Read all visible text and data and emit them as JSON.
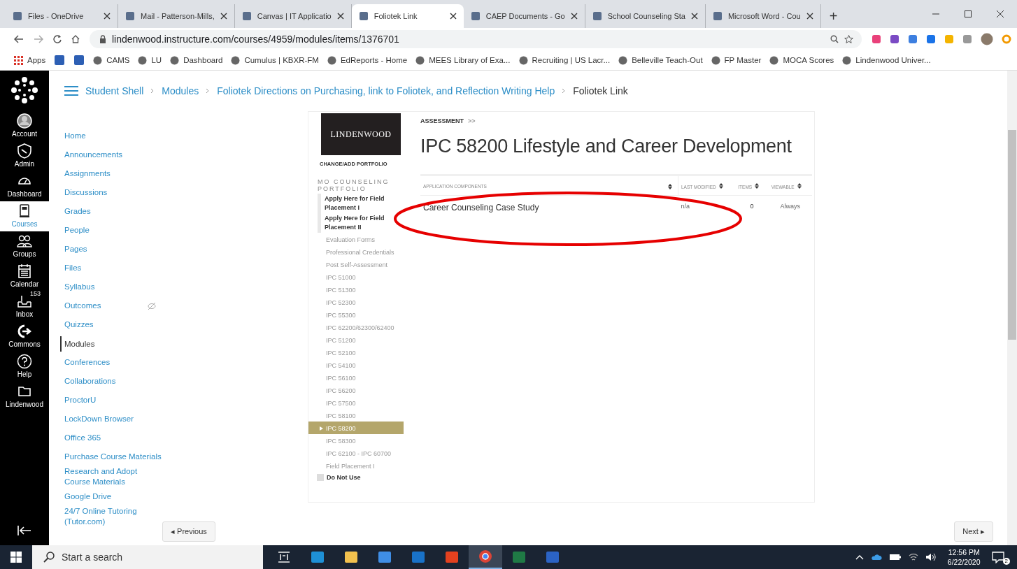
{
  "browser": {
    "tabs": [
      {
        "title": "Files - OneDrive",
        "selected": false
      },
      {
        "title": "Mail - Patterson-Mills,",
        "selected": false
      },
      {
        "title": "Canvas | IT Applicatio",
        "selected": false
      },
      {
        "title": "Foliotek Link",
        "selected": true
      },
      {
        "title": "CAEP Documents - Go",
        "selected": false
      },
      {
        "title": "School Counseling Sta",
        "selected": false
      },
      {
        "title": "Microsoft Word - Cou",
        "selected": false
      }
    ],
    "new_tab": "+",
    "address": "lindenwood.instructure.com/courses/4959/modules/items/1376701",
    "bookmarks": [
      {
        "kind": "apps",
        "label": "Apps"
      },
      {
        "kind": "icon"
      },
      {
        "kind": "icon"
      },
      {
        "kind": "link",
        "label": "CAMS"
      },
      {
        "kind": "link",
        "label": "LU"
      },
      {
        "kind": "link",
        "label": "Dashboard"
      },
      {
        "kind": "link",
        "label": "Cumulus | KBXR-FM"
      },
      {
        "kind": "link",
        "label": "EdReports - Home"
      },
      {
        "kind": "link",
        "label": "MEES Library of Exa..."
      },
      {
        "kind": "link",
        "label": "Recruiting | US Lacr..."
      },
      {
        "kind": "link",
        "label": "Belleville Teach-Out"
      },
      {
        "kind": "link",
        "label": "FP Master"
      },
      {
        "kind": "link",
        "label": "MOCA Scores"
      },
      {
        "kind": "link",
        "label": "Lindenwood Univer..."
      }
    ]
  },
  "global_nav": {
    "items": [
      {
        "kind": "account",
        "label": "Account",
        "selected": false
      },
      {
        "kind": "admin",
        "label": "Admin",
        "selected": false
      },
      {
        "kind": "dashboard",
        "label": "Dashboard",
        "selected": false
      },
      {
        "kind": "courses",
        "label": "Courses",
        "selected": true
      },
      {
        "kind": "groups",
        "label": "Groups",
        "selected": false
      },
      {
        "kind": "calendar",
        "label": "Calendar",
        "selected": false
      },
      {
        "kind": "inbox",
        "label": "Inbox",
        "badge": "153",
        "selected": false
      },
      {
        "kind": "commons",
        "label": "Commons",
        "selected": false
      },
      {
        "kind": "help",
        "label": "Help",
        "selected": false
      },
      {
        "kind": "folder",
        "label": "Lindenwood",
        "selected": false
      }
    ]
  },
  "breadcrumb": [
    "Student Shell",
    "Modules",
    "Foliotek Directions on Purchasing, link to Foliotek, and Reflection Writing Help",
    "Foliotek Link"
  ],
  "course_nav": [
    {
      "label": "Home",
      "selected": false,
      "hidden": false
    },
    {
      "label": "Announcements",
      "selected": false,
      "hidden": false
    },
    {
      "label": "Assignments",
      "selected": false,
      "hidden": false
    },
    {
      "label": "Discussions",
      "selected": false,
      "hidden": false
    },
    {
      "label": "Grades",
      "selected": false,
      "hidden": false
    },
    {
      "label": "People",
      "selected": false,
      "hidden": false
    },
    {
      "label": "Pages",
      "selected": false,
      "hidden": false
    },
    {
      "label": "Files",
      "selected": false,
      "hidden": false
    },
    {
      "label": "Syllabus",
      "selected": false,
      "hidden": false
    },
    {
      "label": "Outcomes",
      "selected": false,
      "hidden": true
    },
    {
      "label": "Quizzes",
      "selected": false,
      "hidden": false
    },
    {
      "label": "Modules",
      "selected": true,
      "hidden": false
    },
    {
      "label": "Conferences",
      "selected": false,
      "hidden": false
    },
    {
      "label": "Collaborations",
      "selected": false,
      "hidden": false
    },
    {
      "label": "ProctorU",
      "selected": false,
      "hidden": false
    },
    {
      "label": "LockDown Browser",
      "selected": false,
      "hidden": false
    },
    {
      "label": "Office 365",
      "selected": false,
      "hidden": false
    },
    {
      "label": "Purchase Course Materials",
      "selected": false,
      "hidden": false
    },
    {
      "label": "Research and Adopt Course Materials",
      "selected": false,
      "hidden": false
    },
    {
      "label": "Google Drive",
      "selected": false,
      "hidden": false
    },
    {
      "label": "24/7 Online Tutoring (Tutor.com)",
      "selected": false,
      "hidden": false
    }
  ],
  "foliotek": {
    "logo": "LINDENWOOD",
    "change_portfolio": "CHANGE/ADD PORTFOLIO",
    "portfolio_title": "MO COUNSELING PORTFOLIO",
    "sections": [
      {
        "kind": "group",
        "label": "Apply Here for Field Placement I",
        "selected": false
      },
      {
        "kind": "group",
        "label": "Apply Here for Field Placement II",
        "selected": false
      },
      {
        "kind": "item",
        "label": "Evaluation Forms",
        "selected": false
      },
      {
        "kind": "item",
        "label": "Professional Credentials",
        "selected": false
      },
      {
        "kind": "item",
        "label": "Post Self-Assessment",
        "selected": false
      },
      {
        "kind": "item",
        "label": "IPC 51000",
        "selected": false
      },
      {
        "kind": "item",
        "label": "IPC 51300",
        "selected": false
      },
      {
        "kind": "item",
        "label": "IPC 52300",
        "selected": false
      },
      {
        "kind": "item",
        "label": "IPC 55300",
        "selected": false
      },
      {
        "kind": "item",
        "label": "IPC 62200/62300/62400",
        "selected": false
      },
      {
        "kind": "item",
        "label": "IPC 51200",
        "selected": false
      },
      {
        "kind": "item",
        "label": "IPC 52100",
        "selected": false
      },
      {
        "kind": "item",
        "label": "IPC 54100",
        "selected": false
      },
      {
        "kind": "item",
        "label": "IPC 56100",
        "selected": false
      },
      {
        "kind": "item",
        "label": "IPC 56200",
        "selected": false
      },
      {
        "kind": "item",
        "label": "IPC 57500",
        "selected": false
      },
      {
        "kind": "item",
        "label": "IPC 58100",
        "selected": false
      },
      {
        "kind": "item",
        "label": "IPC 58200",
        "selected": true
      },
      {
        "kind": "item",
        "label": "IPC 58300",
        "selected": false
      },
      {
        "kind": "item",
        "label": "IPC 62100 - IPC 60700",
        "selected": false
      },
      {
        "kind": "item",
        "label": "Field Placement I",
        "selected": false
      },
      {
        "kind": "folder",
        "label": "Do Not Use",
        "selected": false
      }
    ],
    "crumb": "ASSESSMENT",
    "crumb_sep": ">>",
    "title": "IPC 58200 Lifestyle and Career Development",
    "table": {
      "columns": [
        "APPLICATION COMPONENTS",
        "LAST MODIFIED",
        "ITEMS",
        "VIEWABLE"
      ],
      "rows": [
        [
          "Career Counseling Case Study",
          "n/a",
          "0",
          "Always"
        ]
      ]
    }
  },
  "pager": {
    "previous": "◂ Previous",
    "next": "Next ▸"
  },
  "taskbar": {
    "search": "Start a search",
    "apps": [
      {
        "selected": false
      },
      {
        "selected": false
      },
      {
        "selected": false
      },
      {
        "selected": false
      },
      {
        "selected": false
      },
      {
        "selected": false
      },
      {
        "selected": true
      },
      {
        "selected": false
      },
      {
        "selected": false
      }
    ],
    "time": "12:56 PM",
    "date": "6/22/2020",
    "notifications": "2"
  }
}
